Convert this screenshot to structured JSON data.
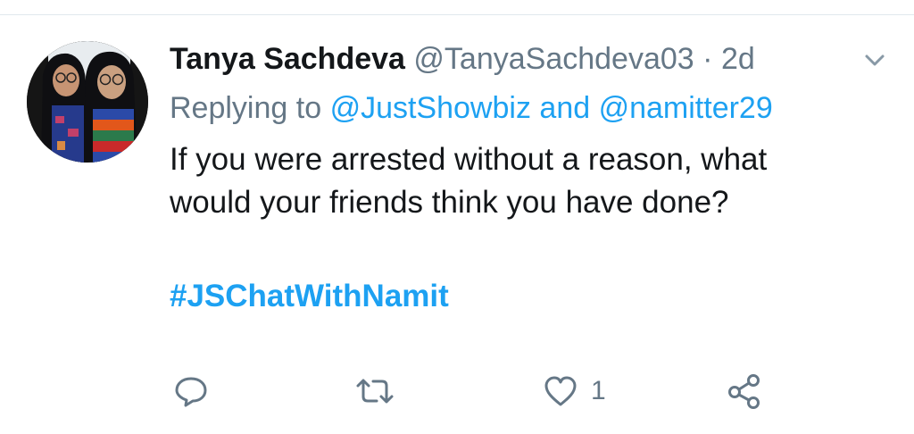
{
  "tweet": {
    "author": {
      "display_name": "Tanya Sachdeva",
      "handle": "@TanyaSachdeva03",
      "avatar_icon": "profile-photo"
    },
    "separator": "·",
    "timestamp": "2d",
    "reply_context": {
      "prefix": "Replying to",
      "mention_1": "@JustShowbiz",
      "conjunction": "and",
      "mention_2": "@namitter29"
    },
    "text_line_1": "If you were arrested without a reason, what",
    "text_line_2": "would your friends think you have done?",
    "hashtag": "#JSChatWithNamit",
    "actions": {
      "reply_icon": "comment-icon",
      "retweet_icon": "retweet-icon",
      "like_icon": "heart-icon",
      "like_count": "1",
      "share_icon": "share-icon"
    }
  },
  "colors": {
    "accent": "#1da1f2",
    "text_primary": "#14171a",
    "text_secondary": "#657786",
    "divider": "#e1e8ed"
  }
}
